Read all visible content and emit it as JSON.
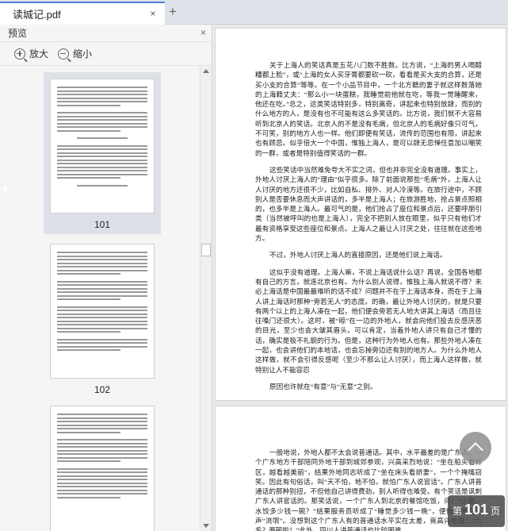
{
  "tab": {
    "title": "读城记.pdf",
    "close_icon": "×",
    "new_tab_icon": "+"
  },
  "preview": {
    "title": "预览",
    "close_icon": "×",
    "zoom_in_label": "放大",
    "zoom_out_label": "缩小",
    "thumbnails": [
      {
        "page": "101",
        "selected": true
      },
      {
        "page": "102",
        "selected": false
      },
      {
        "page": "",
        "selected": false
      }
    ]
  },
  "document": {
    "page1_paragraphs": [
      "关于上海人的笑话真是五花八门数不胜数。比方说，“上海的男人喝醋糟都上脸”，或“上海的女人买牙膏都要砍一砍，看看是买大支的合算，还是买小支的合算”等等。在一个小品节目中，一个北方籍的妻子就这样数落她的上海籍丈夫：“那么小一块蛋糕，我睡觉前他就在吃，等我一觉睡醒来，他还在吃。”总之，这类笑话特别多，特别离奇，讲起来也特别放肆，而别的什么地方的人，是没有也不可能有这么多笑话的。比方说，我们就不大容易听到北京人的笑话。北京人的不是没有毛病，但北京人的毛病好像只可气，不可笑，别的地方人也一样。他们即便有笑话，流传的范围也有限，讲起来也有顾忌。似乎倍大一个中国，惟独上海人，是可以肆无忌惮任意加以嘲笑的一群，或者是特别值得笑话的一群。",
      "这些笑话中当然难免夸大不实之词，但也并非完全没有道理。事实上，外地人讨厌上海人的“理由”似乎很多。除了前面说那些“毛病”外，上海人让人讨厌的地方还很不少，比如自私、排外、对人冷漠等。在旅行途中，不顾别人是否要休息而大声讲话的，多半是上海人；在旅游胜地，抢占景点照相的，也多半是上海人。最可气的是，他们抢占了座位和景点后，还要呼朋引类（当然被呼叫的也是上海人），完全不把别人放在眼里，似乎只有他们才最有资格享受这些座位和景点。上海人之最让人讨厌之处，往往就在这些地方。",
      "不过，外地人讨厌上海人的直接原因，还是他们说上海话。",
      "这似乎没有道理。上海人嘛，不说上海话说什么话？再说，全国各地都有自己的方言，就连北京也有。为什么别人说得，惟独上海人就说不得？未必上海话是中国最最难听的话不成？问题并不在于上海话本身，而在于上海人讲上海话时那种“旁若无人”的态度。的确，最让外地人讨厌的，就是只要有两个以上的上海人凑在一起，他们便会旁若无人地大讲其上海话（而且往往嗓门还很大）。这时，被“晾”在一边的外地人，就会向他们投去反感厌恶的目光，至少也会大皱其眉头。可以肯定，当着外地人讲只有自己才懂的话，确实是极不礼貌的行为。但是，这种行为外地人也有。那些外地人凑在一起，也会讲他们的本地话，也会忘掉旁边还有别的地方人。为什么外地人这样做，就不会引得反感呢（至少不那么让人讨厌），而上海人这样做，就特别让人不能容忍",
      "原因也许就在“有意”与“无意”之别。"
    ],
    "page2_paragraphs": [
      "一般地说，外地人都不太会说普通话。其中，水平最差的是广东人。一个广东地方干部陪同外地干部到城郊参观，兴高采烈地说：“坐在船头看郊区，越看越美丽”，结果外地同志听成了“坐在床头看娇妻”，一个个掩嘴窃笑。因此有句俗话，叫“天不怕，地不怕，就怕广东人说官话”。广东人讲普通话的那种别扭，不但他自己讲得费劲，别人听得也难受。有个笑话是讽刺广东人讲官话的。那笑话说，一个广东人到北京的餐馆吃饭，问：“小姐，水饺多少钱一碗？”结果服务员听成了“睡觉多少钱一晚”，便愤然地骂一声“流氓”。没想到这个广东人有的普通话水平实在太差，竟高兴地说：“六毛？两碗啦！”此外，四川人讲普通话也比较困难，"
    ]
  },
  "fab": {
    "icon": "chevron-up-icon"
  },
  "page_indicator": {
    "prefix": "第",
    "number": "101",
    "suffix": "页"
  }
}
